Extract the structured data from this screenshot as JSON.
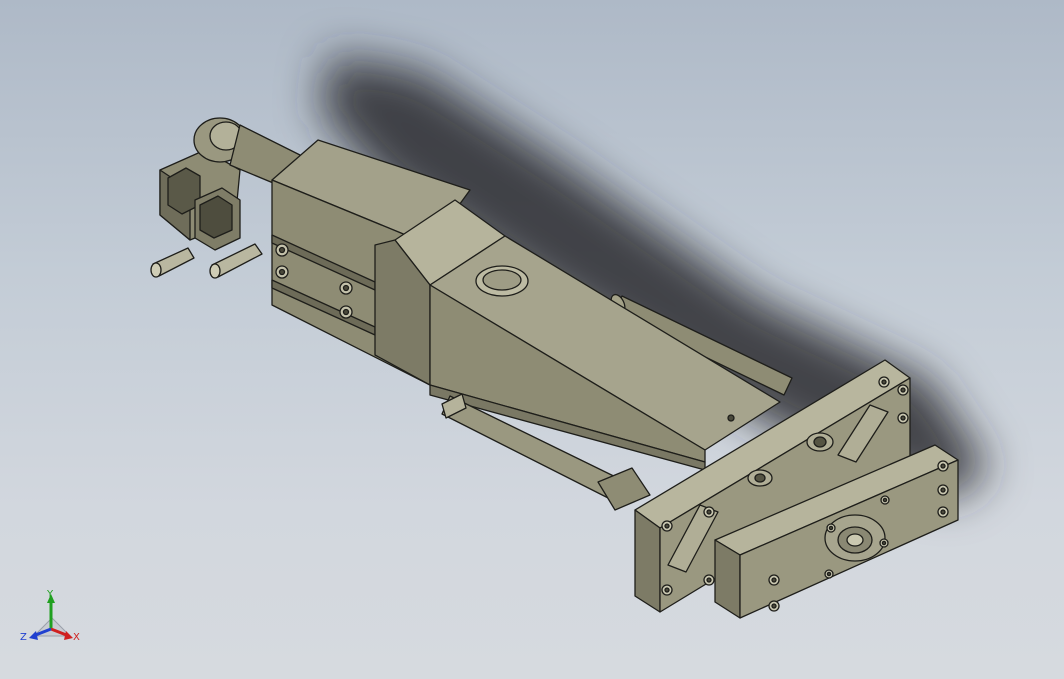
{
  "viewport": {
    "background_top": "#aeb9c7",
    "background_bottom": "#d6dadf",
    "model_color": "#8e8c74"
  },
  "triad": {
    "x_label": "X",
    "y_label": "Y",
    "z_label": "Z",
    "x_color": "#d02020",
    "y_color": "#20a020",
    "z_color": "#2040d0"
  }
}
